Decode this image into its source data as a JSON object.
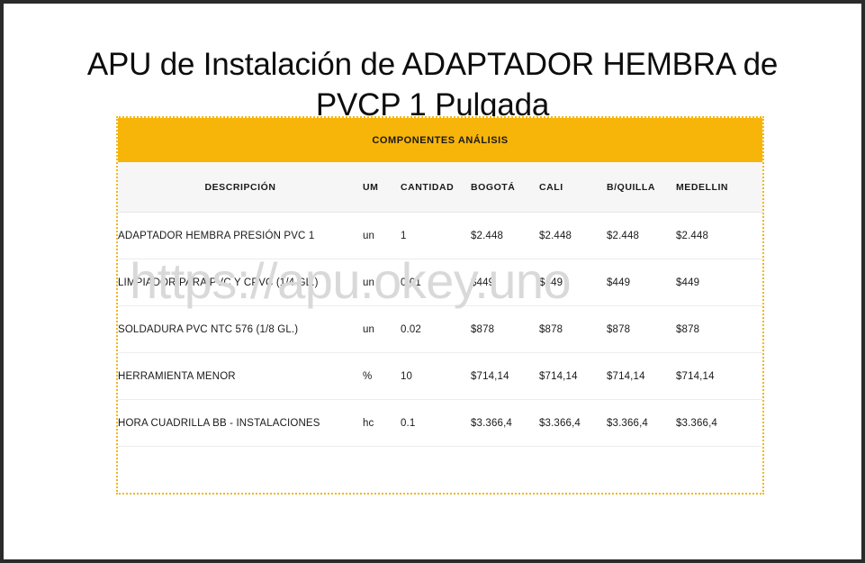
{
  "page": {
    "title": "APU de Instalación de ADAPTADOR HEMBRA de PVCP 1 Pulgada",
    "watermark": "https://apu.okey.uno",
    "border_color": "#2b2b2b",
    "background": "#ffffff"
  },
  "table": {
    "banner": "COMPONENTES ANÁLISIS",
    "banner_color": "#f8b509",
    "border_color": "#f0b71c",
    "header_background": "#f6f6f6",
    "columns": [
      "DESCRIPCIÓN",
      "UM",
      "CANTIDAD",
      "BOGOTÁ",
      "CALI",
      "B/QUILLA",
      "MEDELLIN"
    ],
    "rows": [
      {
        "descripcion": "ADAPTADOR HEMBRA PRESIÓN PVC 1",
        "um": "un",
        "cantidad": "1",
        "bogota": "$2.448",
        "cali": "$2.448",
        "bquilla": "$2.448",
        "medellin": "$2.448"
      },
      {
        "descripcion": "LIMPIADOR PARA PVC Y CPVC (1/4 GL.)",
        "um": "un",
        "cantidad": "0.01",
        "bogota": "$449",
        "cali": "$449",
        "bquilla": "$449",
        "medellin": "$449"
      },
      {
        "descripcion": "SOLDADURA PVC NTC 576 (1/8 GL.)",
        "um": "un",
        "cantidad": "0.02",
        "bogota": "$878",
        "cali": "$878",
        "bquilla": "$878",
        "medellin": "$878"
      },
      {
        "descripcion": "HERRAMIENTA MENOR",
        "um": "%",
        "cantidad": "10",
        "bogota": "$714,14",
        "cali": "$714,14",
        "bquilla": "$714,14",
        "medellin": "$714,14"
      },
      {
        "descripcion": "HORA CUADRILLA BB - INSTALACIONES",
        "um": "hc",
        "cantidad": "0.1",
        "bogota": "$3.366,4",
        "cali": "$3.366,4",
        "bquilla": "$3.366,4",
        "medellin": "$3.366,4"
      }
    ]
  }
}
